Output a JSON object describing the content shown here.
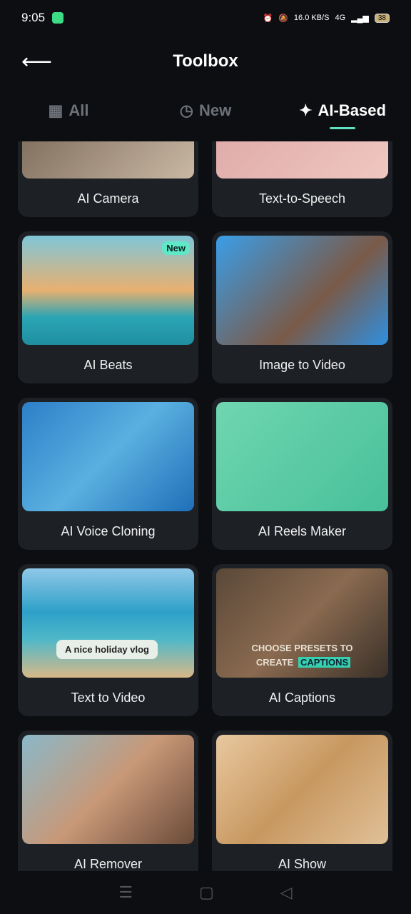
{
  "status": {
    "time": "9:05",
    "speed": "16.0 KB/S",
    "network": "4G",
    "battery": "38"
  },
  "header": {
    "title": "Toolbox"
  },
  "tabs": [
    {
      "label": "All",
      "icon": "grid-icon"
    },
    {
      "label": "New",
      "icon": "clock-icon"
    },
    {
      "label": "AI-Based",
      "icon": "sparkle-icon",
      "active": true
    }
  ],
  "tools": [
    {
      "label": "AI Camera",
      "bg": "linear-gradient(135deg,#6b5a48,#c9b8a4)"
    },
    {
      "label": "Text-to-Speech",
      "bg": "linear-gradient(135deg,#d9a3a3,#f0c7c0)"
    },
    {
      "label": "AI Beats",
      "bg": "linear-gradient(180deg,#7fc6d8 0%,#e8b070 50%,#2aa5b5 75%,#1f8fa0 100%)",
      "badge": "New"
    },
    {
      "label": "Image to Video",
      "bg": "linear-gradient(135deg,#3a9ee8,#7a5a48 60%,#2f8fe0)"
    },
    {
      "label": "AI Voice Cloning",
      "bg": "linear-gradient(135deg,#2d7fc8,#5ab0e0 50%,#1f6fb8)"
    },
    {
      "label": "AI Reels Maker",
      "bg": "linear-gradient(135deg,#6fd6b0,#48c09a)"
    },
    {
      "label": "Text to Video",
      "bg": "linear-gradient(180deg,#8fc8e8 0%,#2ea0c8 40%,#4fb8c8 65%,#d8b888 100%)",
      "caption": "A nice holiday vlog"
    },
    {
      "label": "AI Captions",
      "bg": "linear-gradient(135deg,#5a4838,#8a6a50 50%,#3a3028)",
      "caption_lines": [
        "CHOOSE  PRESETS TO",
        "CREATE"
      ],
      "caption_highlight": "CAPTIONS"
    },
    {
      "label": "AI Remover",
      "bg": "linear-gradient(135deg,#8ab8c8,#c89878 50%,#6a4a38)"
    },
    {
      "label": "AI Show",
      "bg": "linear-gradient(135deg,#e8c8a0,#c89860 50%,#e0c098)"
    }
  ]
}
